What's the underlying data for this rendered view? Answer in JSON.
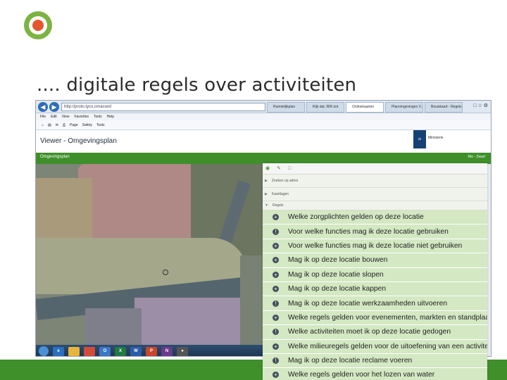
{
  "slide": {
    "title": ".... digitale regels over activiteiten"
  },
  "browser": {
    "address": "http://proto.tyco.omaconl/",
    "tabs": [
      {
        "label": "Ruimtelijkplan",
        "active": false
      },
      {
        "label": "Rijk dat, RIR ont",
        "active": false
      },
      {
        "label": "Onlinekaarten",
        "active": true
      },
      {
        "label": "Planomgevingen V...",
        "active": false
      },
      {
        "label": "Bouwkaart - Regels",
        "active": false
      }
    ],
    "menu": [
      "File",
      "Edit",
      "View",
      "Favorites",
      "Tools",
      "Help"
    ],
    "commands": [
      "Page",
      "Safety",
      "Tools"
    ]
  },
  "viewer": {
    "title": "Viewer - Omgevingsplan",
    "ministry": "Ministerie",
    "strip_left": "Omgevingsplan",
    "strip_right": "Rin - Zwart"
  },
  "panel": {
    "tools": [
      "eye-icon",
      "pencil-icon",
      "square-icon"
    ],
    "sections": [
      {
        "label": "Zoeken op adres"
      },
      {
        "label": "Kaartlagen"
      },
      {
        "label": "Regels"
      }
    ],
    "rules": [
      {
        "label": "Welke zorgplichten gelden op deze locatie",
        "icon": "plus"
      },
      {
        "label": "Voor welke functies mag ik deze locatie gebruiken",
        "icon": "info"
      },
      {
        "label": "Voor welke functies mag ik deze locatie niet gebruiken",
        "icon": "plus"
      },
      {
        "label": "Mag ik op deze locatie bouwen",
        "icon": "plus"
      },
      {
        "label": "Mag ik op deze locatie slopen",
        "icon": "plus"
      },
      {
        "label": "Mag ik op deze locatie kappen",
        "icon": "plus"
      },
      {
        "label": "Mag ik op deze locatie werkzaamheden uitvoeren",
        "icon": "info"
      },
      {
        "label": "Welke regels gelden voor evenementen, markten en standplaats",
        "icon": "plus"
      },
      {
        "label": "Welke activiteiten moet ik op deze locatie gedogen",
        "icon": "info"
      },
      {
        "label": "Welke milieuregels gelden voor de uitoefening van een activiteit",
        "icon": "plus"
      },
      {
        "label": "Mag ik op deze locatie reclame voeren",
        "icon": "info"
      },
      {
        "label": "Welke regels gelden voor het lozen van water",
        "icon": "plus"
      }
    ]
  },
  "colors": {
    "accent_green": "#3f8f2a",
    "rule_bg": "#d3e8c3",
    "logo_green": "#7cb342",
    "logo_orange": "#e4572e"
  }
}
